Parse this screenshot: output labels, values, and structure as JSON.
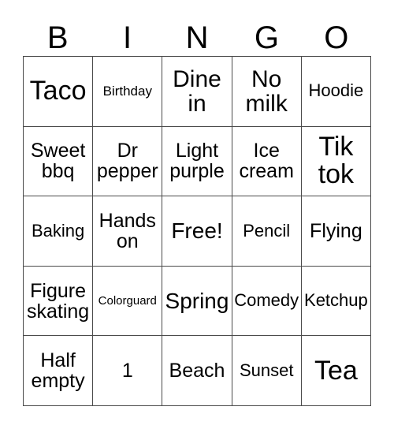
{
  "card": {
    "title": "BINGO",
    "header_letters": [
      "B",
      "I",
      "N",
      "G",
      "O"
    ],
    "grid_size": "5x5",
    "free_space": "Free!",
    "colors": {
      "background": "#ffffff",
      "text": "#000000",
      "border": "#4a4a4a"
    },
    "rows": [
      [
        {
          "label": "Taco",
          "size": "sz-xxl"
        },
        {
          "label": "Birthday",
          "size": "sz-xs"
        },
        {
          "label": "Dine in",
          "size": "sz-xl"
        },
        {
          "label": "No milk",
          "size": "sz-xl"
        },
        {
          "label": "Hoodie",
          "size": "sz-sm"
        }
      ],
      [
        {
          "label": "Sweet bbq",
          "size": "sz-md"
        },
        {
          "label": "Dr pepper",
          "size": "sz-md"
        },
        {
          "label": "Light purple",
          "size": "sz-md"
        },
        {
          "label": "Ice cream",
          "size": "sz-md"
        },
        {
          "label": "Tik tok",
          "size": "sz-xxl"
        }
      ],
      [
        {
          "label": "Baking",
          "size": "sz-sm"
        },
        {
          "label": "Hands on",
          "size": "sz-md"
        },
        {
          "label": "Free!",
          "size": "sz-lg"
        },
        {
          "label": "Pencil",
          "size": "sz-sm"
        },
        {
          "label": "Flying",
          "size": "sz-md"
        }
      ],
      [
        {
          "label": "Figure skating",
          "size": "sz-md"
        },
        {
          "label": "Colorguard",
          "size": "sz-xxs"
        },
        {
          "label": "Spring",
          "size": "sz-lg"
        },
        {
          "label": "Comedy",
          "size": "sz-sm"
        },
        {
          "label": "Ketchup",
          "size": "sz-sm"
        }
      ],
      [
        {
          "label": "Half empty",
          "size": "sz-md"
        },
        {
          "label": "1",
          "size": "sz-md"
        },
        {
          "label": "Beach",
          "size": "sz-md"
        },
        {
          "label": "Sunset",
          "size": "sz-sm"
        },
        {
          "label": "Tea",
          "size": "sz-xxl"
        }
      ]
    ]
  }
}
